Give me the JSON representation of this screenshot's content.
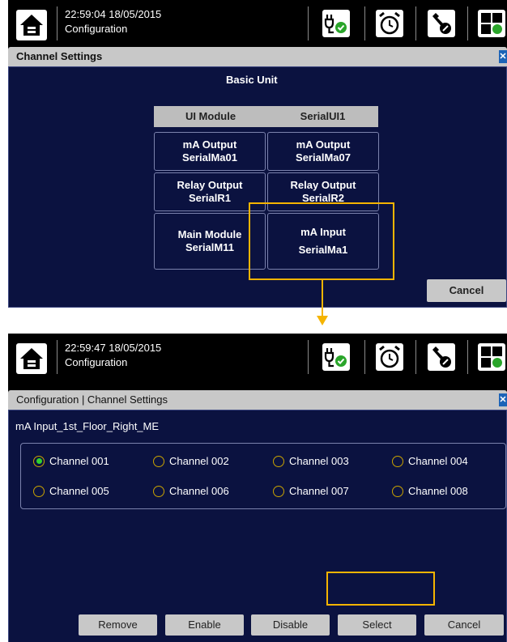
{
  "screen1": {
    "time": "22:59:04 18/05/2015",
    "breadcrumb": "Configuration",
    "dialog_title": "Channel Settings",
    "unit_title": "Basic Unit",
    "headers": [
      "UI Module",
      "SerialUI1"
    ],
    "cells": [
      {
        "line1": "mA Output",
        "line2": "SerialMa01"
      },
      {
        "line1": "mA Output",
        "line2": "SerialMa07"
      },
      {
        "line1": "Relay Output",
        "line2": "SerialR1"
      },
      {
        "line1": "Relay Output",
        "line2": "SerialR2"
      },
      {
        "line1": "Main Module",
        "line2": "SerialM11"
      },
      {
        "line1": "mA Input",
        "line2": "SerialMa1"
      }
    ],
    "cancel_label": "Cancel"
  },
  "screen2": {
    "time": "22:59:47 18/05/2015",
    "breadcrumb": "Configuration",
    "dialog_title": "Configuration | Channel Settings",
    "module_name": "mA Input_1st_Floor_Right_ME",
    "channels": [
      "Channel 001",
      "Channel 002",
      "Channel 003",
      "Channel 004",
      "Channel 005",
      "Channel 006",
      "Channel 007",
      "Channel 008"
    ],
    "selected_channel": "Channel 001",
    "buttons": {
      "remove": "Remove",
      "enable": "Enable",
      "disable": "Disable",
      "select": "Select",
      "cancel": "Cancel"
    }
  },
  "icons": [
    "home-icon",
    "power-plug-check-icon",
    "alarm-clock-icon",
    "tools-icon",
    "module-grid-icon"
  ],
  "colors": {
    "panel_bg": "#0b1240",
    "highlight": "#f5b400",
    "selected_radio": "#2fd12f",
    "button_bg": "#c8c8c8",
    "close_button": "#1c63b7"
  }
}
